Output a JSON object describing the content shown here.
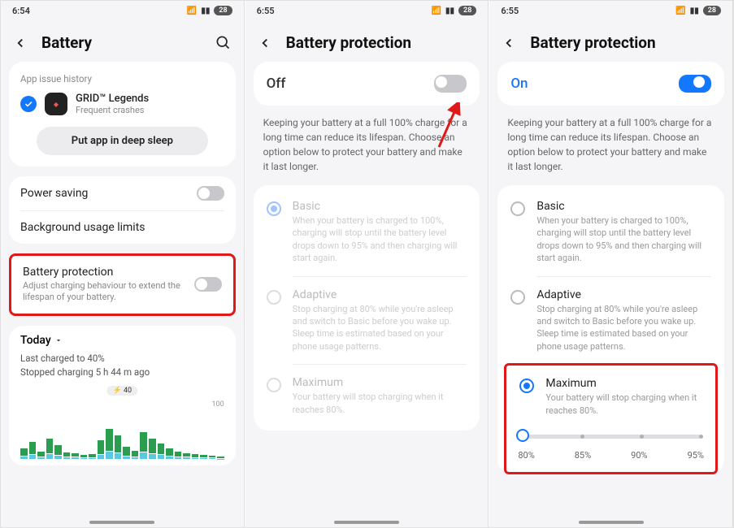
{
  "screen1": {
    "time": "6:54",
    "battery_pct": "28",
    "title": "Battery",
    "history_label": "App issue history",
    "app_name": "GRID™ Legends",
    "app_sub": "Frequent crashes",
    "deep_sleep_btn": "Put app in deep sleep",
    "power_saving": "Power saving",
    "bg_limits": "Background usage limits",
    "bp_title": "Battery protection",
    "bp_sub": "Adjust charging behaviour to extend the lifespan of your battery.",
    "today": "Today",
    "last_charged": "Last charged to 40%",
    "stopped": "Stopped charging 5 h 44 m ago",
    "charge_tag": "⚡ 40",
    "axis_100": "100"
  },
  "screen2": {
    "time": "6:55",
    "battery_pct": "28",
    "title": "Battery protection",
    "state": "Off",
    "desc": "Keeping your battery at a full 100% charge for a long time can reduce its lifespan. Choose an option below to protect your battery and make it last longer.",
    "basic_t": "Basic",
    "basic_d": "When your battery is charged to 100%, charging will stop until the battery level drops down to 95% and then charging will start again.",
    "adaptive_t": "Adaptive",
    "adaptive_d": "Stop charging at 80% while you're asleep and switch to Basic before you wake up. Sleep time is estimated based on your phone usage patterns.",
    "max_t": "Maximum",
    "max_d": "Your battery will stop charging when it reaches 80%."
  },
  "screen3": {
    "time": "6:55",
    "battery_pct": "28",
    "title": "Battery protection",
    "state": "On",
    "desc": "Keeping your battery at a full 100% charge for a long time can reduce its lifespan. Choose an option below to protect your battery and make it last longer.",
    "basic_t": "Basic",
    "basic_d": "When your battery is charged to 100%, charging will stop until the battery level drops down to 95% and then charging will start again.",
    "adaptive_t": "Adaptive",
    "adaptive_d": "Stop charging at 80% while you're asleep and switch to Basic before you wake up. Sleep time is estimated based on your phone usage patterns.",
    "max_t": "Maximum",
    "max_d": "Your battery will stop charging when it reaches 80%.",
    "s80": "80%",
    "s85": "85%",
    "s90": "90%",
    "s95": "95%"
  },
  "chart_data": {
    "type": "bar",
    "title": "Today usage",
    "bars_a": [
      15,
      25,
      10,
      30,
      20,
      9,
      8,
      5,
      6,
      28,
      45,
      35,
      18,
      12,
      40,
      30,
      22,
      15,
      10,
      8,
      6,
      5,
      4,
      3
    ],
    "bars_b": [
      5,
      8,
      4,
      10,
      7,
      3,
      3,
      2,
      2,
      9,
      15,
      12,
      6,
      4,
      13,
      10,
      8,
      5,
      4,
      3,
      2,
      2,
      2,
      1
    ],
    "ylim": [
      0,
      100
    ]
  }
}
